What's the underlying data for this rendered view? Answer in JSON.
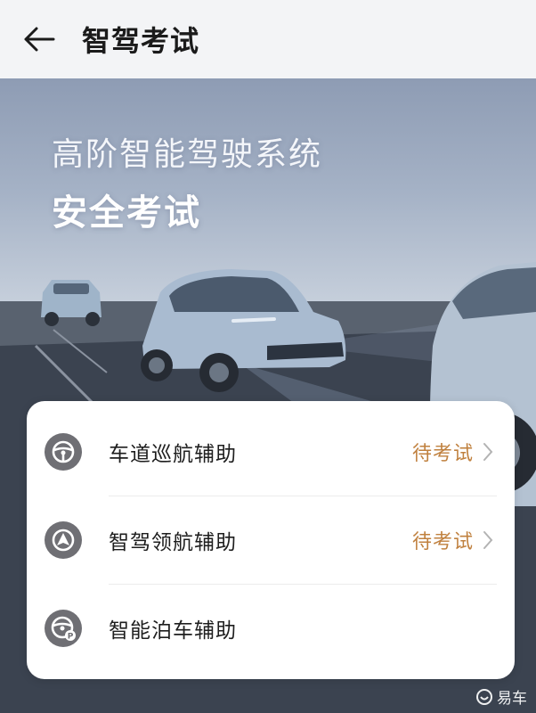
{
  "header": {
    "title": "智驾考试",
    "back_icon": "arrow-left-icon"
  },
  "hero": {
    "subtitle": "高阶智能驾驶系统",
    "title": "安全考试"
  },
  "exam_list": {
    "items": [
      {
        "label": "车道巡航辅助",
        "status": "待考试",
        "icon": "steering-wheel-icon"
      },
      {
        "label": "智驾领航辅助",
        "status": "待考试",
        "icon": "navigation-arrow-icon"
      },
      {
        "label": "智能泊车辅助",
        "status": "",
        "icon": "parking-wheel-icon"
      }
    ]
  },
  "watermark": {
    "text": "易车",
    "icon": "yiche-logo-icon"
  },
  "colors": {
    "status_accent": "#c0813f",
    "icon_bg": "#6f6f74",
    "header_bg": "#f3f4f6"
  }
}
